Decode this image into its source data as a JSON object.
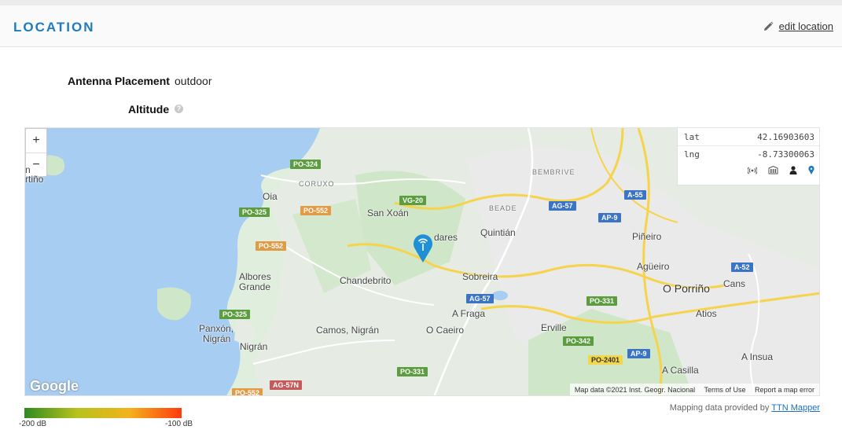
{
  "header": {
    "title": "LOCATION",
    "edit_label": "edit location"
  },
  "fields": {
    "placement_label": "Antenna Placement",
    "placement_value": "outdoor",
    "altitude_label": "Altitude"
  },
  "map": {
    "zoom_in": "+",
    "zoom_out": "−",
    "lat_label": "lat",
    "lat_value": "42.16903603",
    "lng_label": "lng",
    "lng_value": "-8.73300063",
    "logo": "Google",
    "attribution": {
      "data": "Map data ©2021 Inst. Geogr. Nacional",
      "terms": "Terms of Use",
      "report": "Report a map error"
    },
    "places": {
      "oia": "Oia",
      "san_xoan": "San Xoán",
      "quintian": "Quintián",
      "pineiro": "Piñeiro",
      "agueiro": "Agüeiro",
      "o_porrino": "O Porriño",
      "cans": "Cans",
      "albores_1": "Albores",
      "albores_2": "Grande",
      "chandebrito": "Chandebrito",
      "sobreira": "Sobreira",
      "a_fraga": "A Fraga",
      "atios": "Atios",
      "panxon_1": "Panxón,",
      "panxon_2": "Nigrán",
      "nigran": "Nigrán",
      "camos": "Camos, Nigrán",
      "o_caeiro": "O Caeiro",
      "erville": "Erville",
      "a_insua": "A Insua",
      "a_casilla": "A Casilla",
      "coruxo": "CORUXO",
      "beade": "BEADE",
      "bembrive": "BEMBRIVE",
      "vendares": "dares",
      "edge_1": "n",
      "edge_2": "rtiño"
    },
    "roads": {
      "po324": "PO-324",
      "po325a": "PO-325",
      "po552a": "PO-552",
      "po552b": "PO-552",
      "po325b": "PO-325",
      "vg20": "VG-20",
      "ag57a": "AG-57",
      "ap9a": "AP-9",
      "a55": "A-55",
      "a52": "A-52",
      "ag57b": "AG-57",
      "po331a": "PO-331",
      "po342": "PO-342",
      "ap9b": "AP-9",
      "po2401": "PO-2401",
      "po331b": "PO-331",
      "ag57n": "AG-57N",
      "po552c": "PO-552"
    },
    "icons": [
      "gateway-icon",
      "building-icon",
      "person-icon",
      "pin-icon"
    ]
  },
  "scale": {
    "min_label": "-200 dB",
    "max_label": "-100 dB"
  },
  "credit": {
    "prefix": "Mapping data provided by ",
    "link": "TTN Mapper"
  },
  "colors": {
    "accent": "#1f7bbf",
    "marker": "#1f8fd6",
    "water": "#a7cdf2"
  }
}
